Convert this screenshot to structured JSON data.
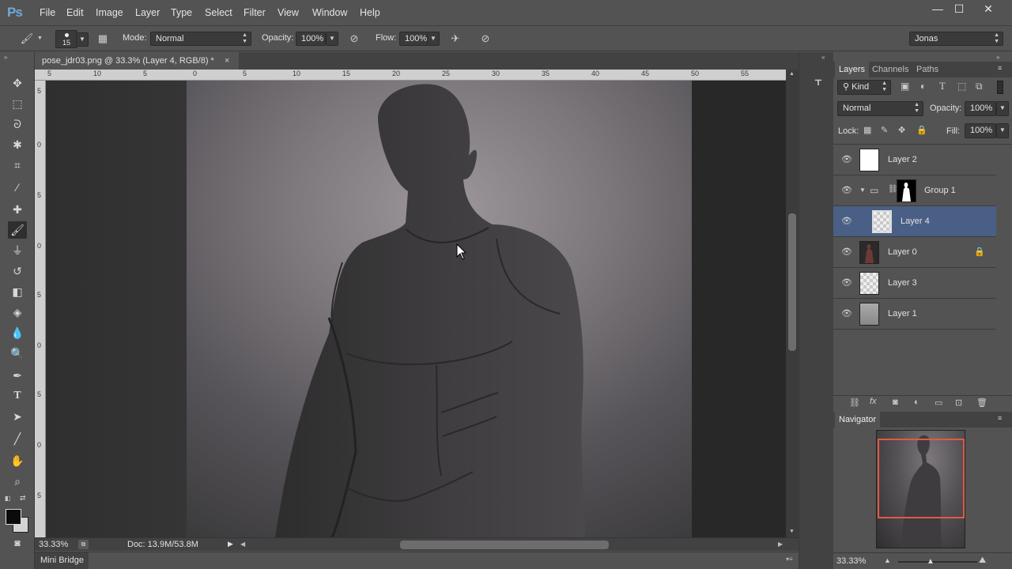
{
  "app": {
    "logo": "Ps",
    "user": "Jonas"
  },
  "menu": [
    "File",
    "Edit",
    "Image",
    "Layer",
    "Type",
    "Select",
    "Filter",
    "View",
    "Window",
    "Help"
  ],
  "window_controls": {
    "minimize": "—",
    "maximize": "☐",
    "close": "✕"
  },
  "options": {
    "brush_size": "15",
    "mode_label": "Mode:",
    "mode_value": "Normal",
    "opacity_label": "Opacity:",
    "opacity_value": "100%",
    "flow_label": "Flow:",
    "flow_value": "100%"
  },
  "document": {
    "tab_title": "pose_jdr03.png @ 33.3% (Layer 4, RGB/8) *",
    "close_glyph": "×",
    "zoom": "33.33%",
    "doc_info": "Doc: 13.9M/53.8M"
  },
  "ruler": {
    "h_labels": [
      "5",
      "10",
      "5",
      "0",
      "5",
      "10",
      "15",
      "20",
      "25",
      "30",
      "35",
      "40",
      "45",
      "50",
      "55"
    ],
    "v_labels": [
      "5",
      "0",
      "5",
      "0",
      "5",
      "0",
      "5",
      "0",
      "5"
    ]
  },
  "bottom_panel": {
    "label": "Mini Bridge"
  },
  "layers_panel": {
    "tabs": [
      "Layers",
      "Channels",
      "Paths"
    ],
    "filter_kind": "Kind",
    "blend_mode": "Normal",
    "opacity_label": "Opacity:",
    "opacity_value": "100%",
    "lock_label": "Lock:",
    "fill_label": "Fill:",
    "fill_value": "100%",
    "layers": [
      {
        "name": "Layer 2",
        "selected": false,
        "thumb": "white"
      },
      {
        "name": "Group 1",
        "selected": false,
        "thumb": "mask"
      },
      {
        "name": "Layer 4",
        "selected": true,
        "thumb": "checker"
      },
      {
        "name": "Layer 0",
        "selected": false,
        "thumb": "figure",
        "locked": true
      },
      {
        "name": "Layer 3",
        "selected": false,
        "thumb": "checker"
      },
      {
        "name": "Layer 1",
        "selected": false,
        "thumb": "gray"
      }
    ]
  },
  "navigator": {
    "title": "Navigator",
    "zoom": "33.33%"
  },
  "colors": {
    "accent_selection": "#4a5f85",
    "nav_box": "#e15a45",
    "panel_bg": "#535353"
  }
}
